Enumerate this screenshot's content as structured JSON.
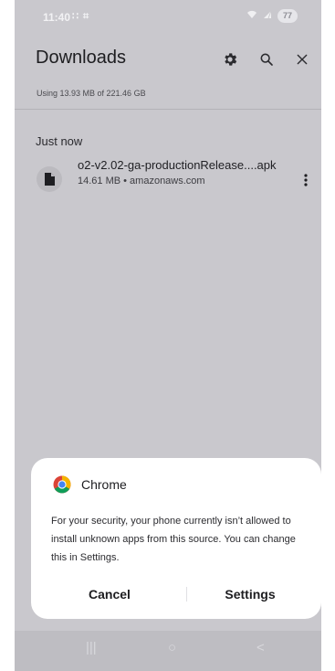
{
  "status_bar": {
    "time": "11:40",
    "left_icons": "∷ ⌗",
    "battery": "77"
  },
  "app_bar": {
    "title": "Downloads"
  },
  "storage": {
    "usage_text": "Using 13.93 MB of 221.46 GB"
  },
  "downloads": {
    "section_header": "Just now",
    "items": [
      {
        "name": "o2-v2.02-ga-productionRelease....apk",
        "meta": "14.61 MB • amazonaws.com"
      }
    ]
  },
  "dialog": {
    "app_name": "Chrome",
    "message": "For your security, your phone currently isn’t allowed to install unknown apps from this source. You can change this in Settings.",
    "cancel_label": "Cancel",
    "settings_label": "Settings"
  },
  "nav_bar": {
    "recent": "|||",
    "home": "○",
    "back": "<"
  },
  "colors": {
    "backdrop": "#c9c8cd",
    "dialog_bg": "#ffffff",
    "text": "#1d1d20"
  },
  "icons": [
    "settings-icon",
    "search-icon",
    "close-icon",
    "file-icon",
    "more-vert-icon",
    "chrome-icon"
  ]
}
